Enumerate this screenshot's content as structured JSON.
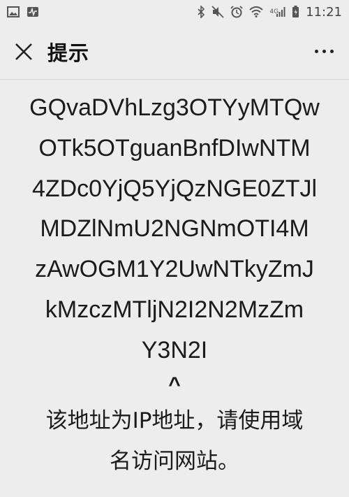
{
  "statusbar": {
    "left_icons": [
      "gallery-icon",
      "activity-monitor-icon"
    ],
    "right_icons": [
      "bluetooth-icon",
      "mute-icon",
      "alarm-icon",
      "wifi-icon",
      "signal-4g-icon",
      "battery-icon"
    ],
    "network_type": "4G",
    "time": "11:21"
  },
  "nav": {
    "close_icon": "close-icon",
    "title": "提示",
    "more_icon": "more-dots-icon"
  },
  "content": {
    "hash_lines": [
      "GQvaDVhLzg3OTYyMTQw",
      "OTk5OTguanBnfDIwNTM",
      "4ZDc0YjQ5YjQzNGE0ZTJl",
      "MDZlNmU2NGNmOTI4M",
      "zAwOGM1Y2UwNTkyZmJ",
      "kMzczMTljN2I2N2MzZm",
      "Y3N2I"
    ],
    "caret": "^",
    "message_lines": [
      "该地址为IP地址，请使用域",
      "名访问网站。"
    ]
  }
}
